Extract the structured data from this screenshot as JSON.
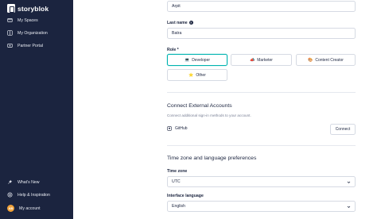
{
  "sidebar": {
    "brand": "storyblok",
    "items": [
      {
        "label": "My Spaces"
      },
      {
        "label": "My Organization"
      },
      {
        "label": "Partner Portal"
      }
    ],
    "bottom_items": [
      {
        "label": "What's New"
      },
      {
        "label": "Help & Inspiration"
      },
      {
        "label": "My account",
        "avatar_initials": "AB"
      }
    ]
  },
  "form": {
    "first_name_value": "Arpit",
    "last_name_label": "Last name",
    "last_name_value": "Batra",
    "role_label": "Role *",
    "roles": [
      {
        "label": "Developer",
        "selected": true
      },
      {
        "label": "Marketer",
        "selected": false
      },
      {
        "label": "Content Creator",
        "selected": false
      },
      {
        "label": "Other",
        "selected": false
      }
    ]
  },
  "external": {
    "title": "Connect External Accounts",
    "subtitle": "Connect additional sign-in methods to your account.",
    "provider": "GitHub",
    "connect_label": "Connect"
  },
  "preferences": {
    "title": "Time zone and language preferences",
    "timezone_label": "Time zone",
    "timezone_value": "UTC",
    "language_label": "Interface language",
    "language_value": "English"
  },
  "colors": {
    "sidebar_bg": "#1b243f",
    "accent": "#00b3b0",
    "avatar": "#f0a23a"
  }
}
